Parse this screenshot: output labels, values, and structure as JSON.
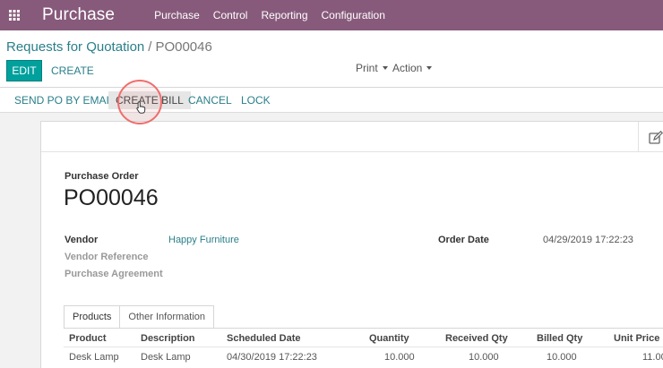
{
  "app": {
    "title": "Purchase",
    "menu": [
      "Purchase",
      "Control",
      "Reporting",
      "Configuration"
    ]
  },
  "breadcrumb": {
    "parent": "Requests for Quotation",
    "separator": "/",
    "current": "PO00046"
  },
  "buttons": {
    "edit": "EDIT",
    "create": "CREATE",
    "print": "Print",
    "action": "Action"
  },
  "statusbar": {
    "send_po": "SEND PO BY EMAIL",
    "create_bill": "CREATE BILL",
    "cancel": "CANCEL",
    "lock": "LOCK"
  },
  "form": {
    "caption": "Purchase Order",
    "number": "PO00046",
    "vendor_label": "Vendor",
    "vendor_value": "Happy Furniture",
    "vendor_ref_label": "Vendor Reference",
    "agreement_label": "Purchase Agreement",
    "order_date_label": "Order Date",
    "order_date_value": "04/29/2019 17:22:23"
  },
  "tabs": {
    "products": "Products",
    "other": "Other Information"
  },
  "table": {
    "headers": [
      "Product",
      "Description",
      "Scheduled Date",
      "Quantity",
      "Received Qty",
      "Billed Qty",
      "Unit Price"
    ],
    "rows": [
      [
        "Desk Lamp",
        "Desk Lamp",
        "04/30/2019 17:22:23",
        "10.000",
        "10.000",
        "10.000",
        "11.00"
      ]
    ]
  },
  "icons": {
    "apps": "apps-grid-icon",
    "edit": "pencil-square-icon",
    "cursor": "hand-pointer-icon"
  },
  "colors": {
    "brand": "#875a7b",
    "primary": "#00a09d",
    "link": "#2a7f8a"
  }
}
